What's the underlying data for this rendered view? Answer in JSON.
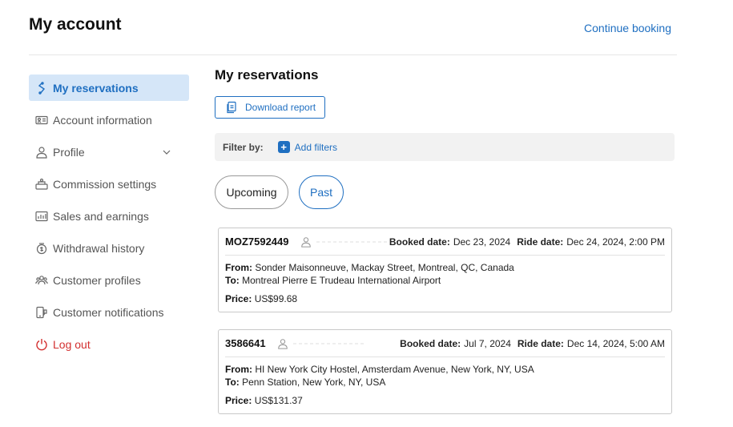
{
  "header": {
    "title": "My account",
    "continue_label": "Continue booking"
  },
  "sidebar": {
    "items": [
      {
        "label": "My reservations",
        "icon": "reservations-icon"
      },
      {
        "label": "Account information",
        "icon": "id-card-icon"
      },
      {
        "label": "Profile",
        "icon": "user-icon"
      },
      {
        "label": "Commission settings",
        "icon": "commission-icon"
      },
      {
        "label": "Sales and earnings",
        "icon": "chart-icon"
      },
      {
        "label": "Withdrawal history",
        "icon": "wallet-icon"
      },
      {
        "label": "Customer profiles",
        "icon": "users-icon"
      },
      {
        "label": "Customer notifications",
        "icon": "notification-icon"
      },
      {
        "label": "Log out",
        "icon": "power-icon"
      }
    ]
  },
  "main": {
    "title": "My reservations",
    "download_label": "Download report",
    "filter_label": "Filter by:",
    "add_filters_label": "Add filters",
    "tabs": [
      {
        "label": "Upcoming"
      },
      {
        "label": "Past"
      }
    ],
    "booked_label": "Booked date:",
    "ride_label": "Ride date:",
    "from_label": "From:",
    "to_label": "To:",
    "price_label": "Price:",
    "reservations": [
      {
        "id": "MOZ7592449",
        "booked": "Dec 23, 2024",
        "ride": "Dec 24, 2024, 2:00 PM",
        "from": "Sonder Maisonneuve, Mackay Street, Montreal, QC, Canada",
        "to": "Montreal Pierre E Trudeau International Airport",
        "price": "US$99.68"
      },
      {
        "id": "3586641",
        "booked": "Jul 7, 2024",
        "ride": "Dec 14, 2024, 5:00 AM",
        "from": "HI New York City Hostel, Amsterdam Avenue, New York, NY, USA",
        "to": "Penn Station, New York, NY, USA",
        "price": "US$131.37"
      }
    ]
  },
  "colors": {
    "accent": "#1f6fc1",
    "active_bg": "#d5e6f8",
    "logout": "#d32f2f"
  }
}
